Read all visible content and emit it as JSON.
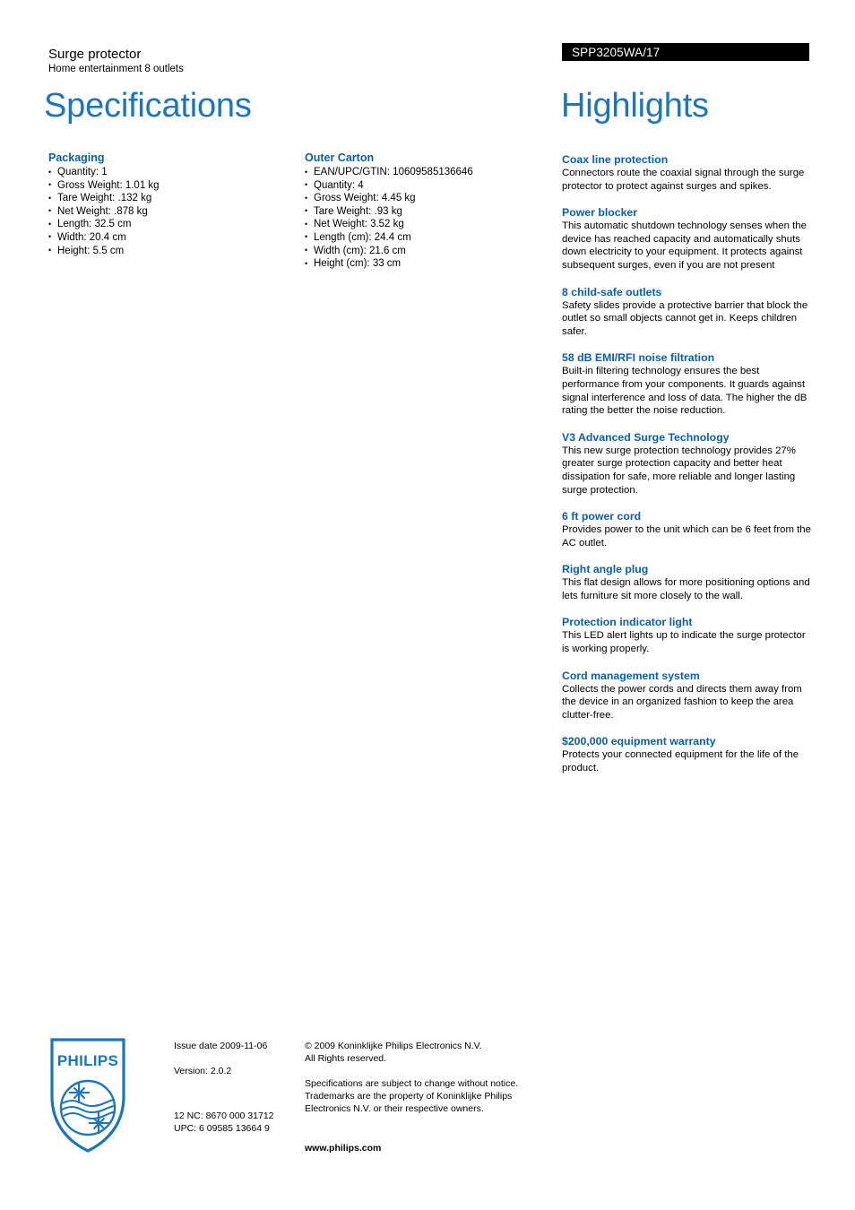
{
  "header": {
    "product_name": "Surge protector",
    "product_subtitle": "Home entertainment 8 outlets",
    "product_code": "SPP3205WA/17",
    "specifications_title": "Specifications",
    "highlights_title": "Highlights"
  },
  "colors": {
    "title_blue": "#1b76bb",
    "heading_blue": "#0b5ea8",
    "code_bar_bg": "#000000",
    "logo_blue": "#1b76bb"
  },
  "specifications": [
    {
      "section": "Packaging",
      "items": [
        "Quantity: 1",
        "Gross Weight: 1.01 kg",
        "Tare Weight: .132 kg",
        "Net Weight: .878 kg",
        "Length: 32.5 cm",
        "Width: 20.4 cm",
        "Height: 5.5 cm"
      ]
    },
    {
      "section": "Outer Carton",
      "items": [
        "EAN/UPC/GTIN: 10609585136646",
        "Quantity: 4",
        "Gross Weight: 4.45 kg",
        "Tare Weight: .93 kg",
        "Net Weight: 3.52 kg",
        "Length (cm): 24.4 cm",
        "Width (cm): 21.6 cm",
        "Height (cm): 33 cm"
      ]
    }
  ],
  "highlights": [
    {
      "title": "Coax line protection",
      "body": "Connectors route the coaxial signal through the surge protector to protect against surges and spikes."
    },
    {
      "title": "Power blocker",
      "body": "This automatic shutdown technology senses when the device has reached capacity and automatically shuts down electricity to your equipment. It protects against subsequent surges, even if you are not present"
    },
    {
      "title": "8 child-safe outlets",
      "body": "Safety slides provide a protective barrier that block the outlet so small objects cannot get in. Keeps children safer."
    },
    {
      "title": "58 dB EMI/RFI noise filtration",
      "body": "Built-in filtering technology ensures the best performance from your components. It guards against signal interference and loss of data. The higher the dB rating the better the noise reduction."
    },
    {
      "title": "V3 Advanced Surge Technology",
      "body": "This new surge protection technology provides 27% greater surge protection capacity and better heat dissipation for safe, more reliable and longer lasting surge protection."
    },
    {
      "title": "6 ft power cord",
      "body": "Provides power to the unit which can be 6 feet from the AC outlet."
    },
    {
      "title": "Right angle plug",
      "body": "This flat design allows for more positioning options and lets furniture sit more closely to the wall."
    },
    {
      "title": "Protection indicator light",
      "body": "This LED alert lights up to indicate the surge protector is working properly."
    },
    {
      "title": "Cord management system",
      "body": "Collects the power cords and directs them away from the device in an organized fashion to keep the area clutter-free."
    },
    {
      "title": "$200,000 equipment warranty",
      "body": "Protects your connected equipment for the life of the product."
    }
  ],
  "footer": {
    "logo_wordmark": "PHILIPS",
    "issue_date": "Issue date 2009-11-06",
    "version": "Version: 2.0.2",
    "twelve_nc": "12 NC: 8670 000 31712",
    "upc": "UPC: 6 09585 13664 9",
    "copyright_line1": "© 2009 Koninklijke Philips Electronics N.V.",
    "copyright_line2": "All Rights reserved.",
    "disclaimer": "Specifications are subject to change without notice. Trademarks are the property of Koninklijke Philips Electronics N.V. or their respective owners.",
    "website": "www.philips.com"
  }
}
